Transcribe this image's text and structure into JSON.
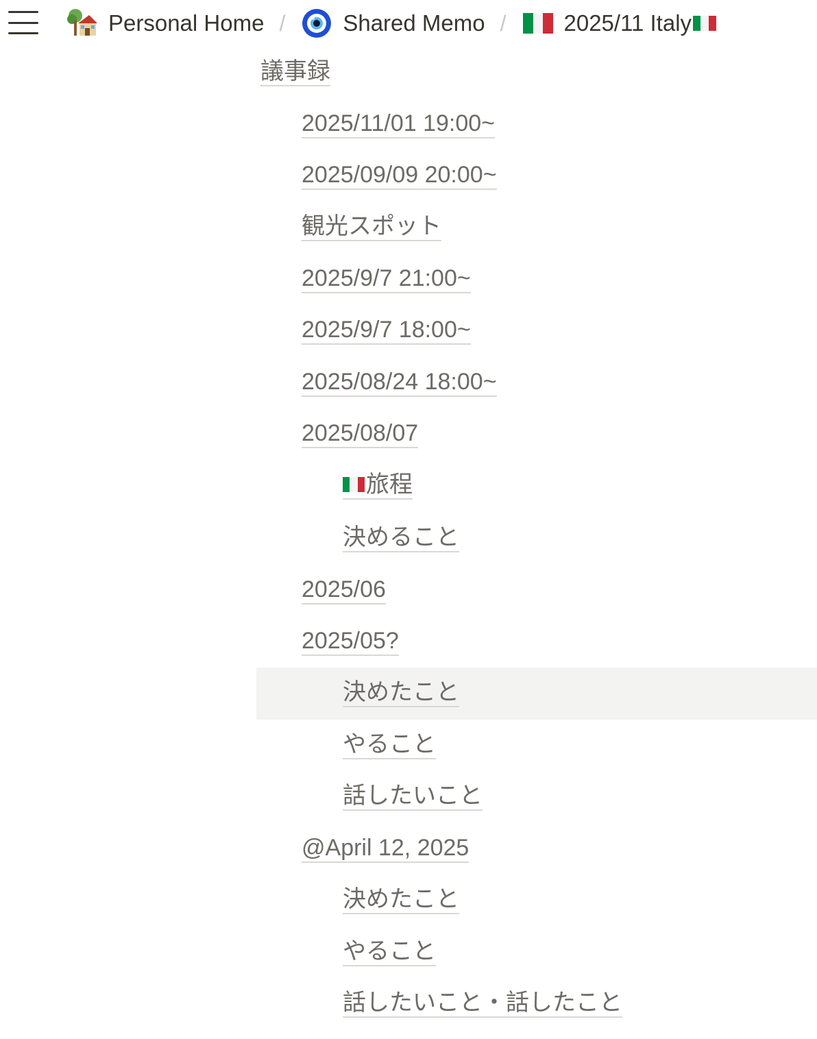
{
  "breadcrumb": {
    "items": [
      {
        "label": "Personal Home",
        "icon": "house-with-tree-icon"
      },
      {
        "label": "Shared Memo",
        "icon": "nazar-amulet-icon"
      },
      {
        "label": "2025/11 Italy",
        "icon": "italy-flag-icon"
      }
    ],
    "separator": "/"
  },
  "outline": {
    "root": "議事録",
    "items": [
      {
        "label": "2025/11/01 19:00~"
      },
      {
        "label": "2025/09/09 20:00~"
      },
      {
        "label": "観光スポット"
      },
      {
        "label": "2025/9/7 21:00~"
      },
      {
        "label": "2025/9/7 18:00~"
      },
      {
        "label": "2025/08/24 18:00~"
      },
      {
        "label": "2025/08/07",
        "children": [
          "旅程",
          "決めること"
        ]
      },
      {
        "label": "2025/06"
      },
      {
        "label": "2025/05?",
        "children": [
          "決めたこと",
          "やること",
          "話したいこと"
        ]
      },
      {
        "label": "@April 12, 2025",
        "children": [
          "決めたこと",
          "やること",
          "話したいこと・話したこと"
        ]
      }
    ]
  },
  "colors": {
    "text": "#37352f",
    "link_text": "#6d6b66",
    "underline": "#d9d8d5",
    "hover_bg": "#f3f3f2",
    "italy_green": "#009246",
    "italy_white": "#ffffff",
    "italy_red": "#ce2b37"
  }
}
